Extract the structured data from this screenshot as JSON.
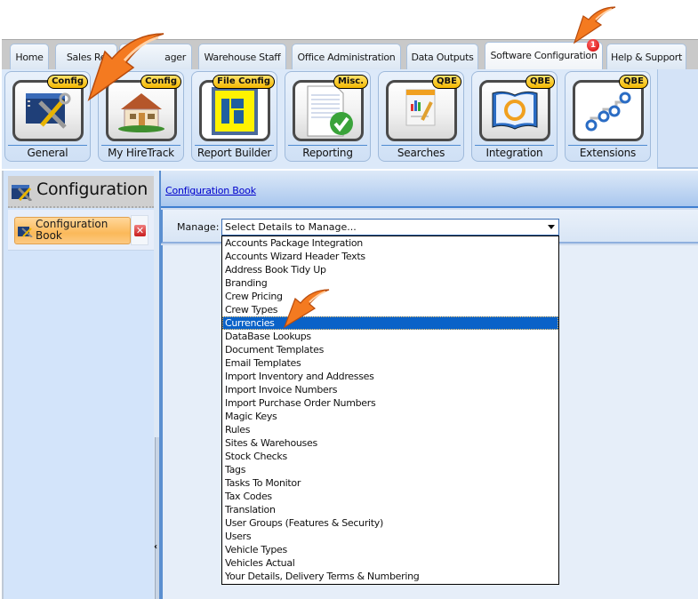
{
  "tabs": [
    {
      "label": "Home"
    },
    {
      "label": "Sales Re"
    },
    {
      "label": "ager"
    },
    {
      "label": "Warehouse Staff"
    },
    {
      "label": "Office Administration"
    },
    {
      "label": "Data Outputs"
    },
    {
      "label": "Software Configuration",
      "active": true,
      "badge": "1"
    },
    {
      "label": "Help & Support"
    }
  ],
  "ribbon": {
    "buttons": [
      {
        "label": "General",
        "tag": "Config",
        "icon": "tools-icon"
      },
      {
        "label": "My HireTrack",
        "tag": "Config",
        "icon": "house-icon"
      },
      {
        "label": "Report Builder",
        "tag": "File Config",
        "icon": "report-builder-icon"
      },
      {
        "label": "Reporting",
        "tag": "Misc.",
        "icon": "report-check-icon"
      },
      {
        "label": "Searches",
        "tag": "QBE",
        "icon": "chart-document-icon"
      },
      {
        "label": "Integration",
        "tag": "QBE",
        "icon": "book-sync-icon"
      },
      {
        "label": "Extensions",
        "tag": "QBE",
        "icon": "nodes-icon"
      }
    ]
  },
  "sidebar": {
    "title": "Configuration",
    "items": [
      {
        "label": "Configuration Book",
        "active": true
      }
    ]
  },
  "main": {
    "breadcrumb": "Configuration Book",
    "manage_label": "Manage:",
    "combo_value": "Select Details to Manage...",
    "options": [
      "Accounts Package Integration",
      "Accounts Wizard Header Texts",
      "Address Book Tidy Up",
      "Branding",
      "Crew Pricing",
      "Crew Types",
      "Currencies",
      "DataBase Lookups",
      "Document Templates",
      "Email Templates",
      "Import Inventory and Addresses",
      "Import Invoice Numbers",
      "Import Purchase Order Numbers",
      "Magic Keys",
      "Rules",
      "Sites & Warehouses",
      "Stock Checks",
      "Tags",
      "Tasks To Monitor",
      "Tax Codes",
      "Translation",
      "User Groups (Features & Security)",
      "Users",
      "Vehicle Types",
      "Vehicles Actual",
      "Your Details, Delivery Terms & Numbering"
    ],
    "selected_option": "Currencies"
  },
  "colors": {
    "selection": "#0a62c8",
    "pointer_arrow": "#f26b1d",
    "badge": "#d10000",
    "tag": "#f3b700"
  }
}
